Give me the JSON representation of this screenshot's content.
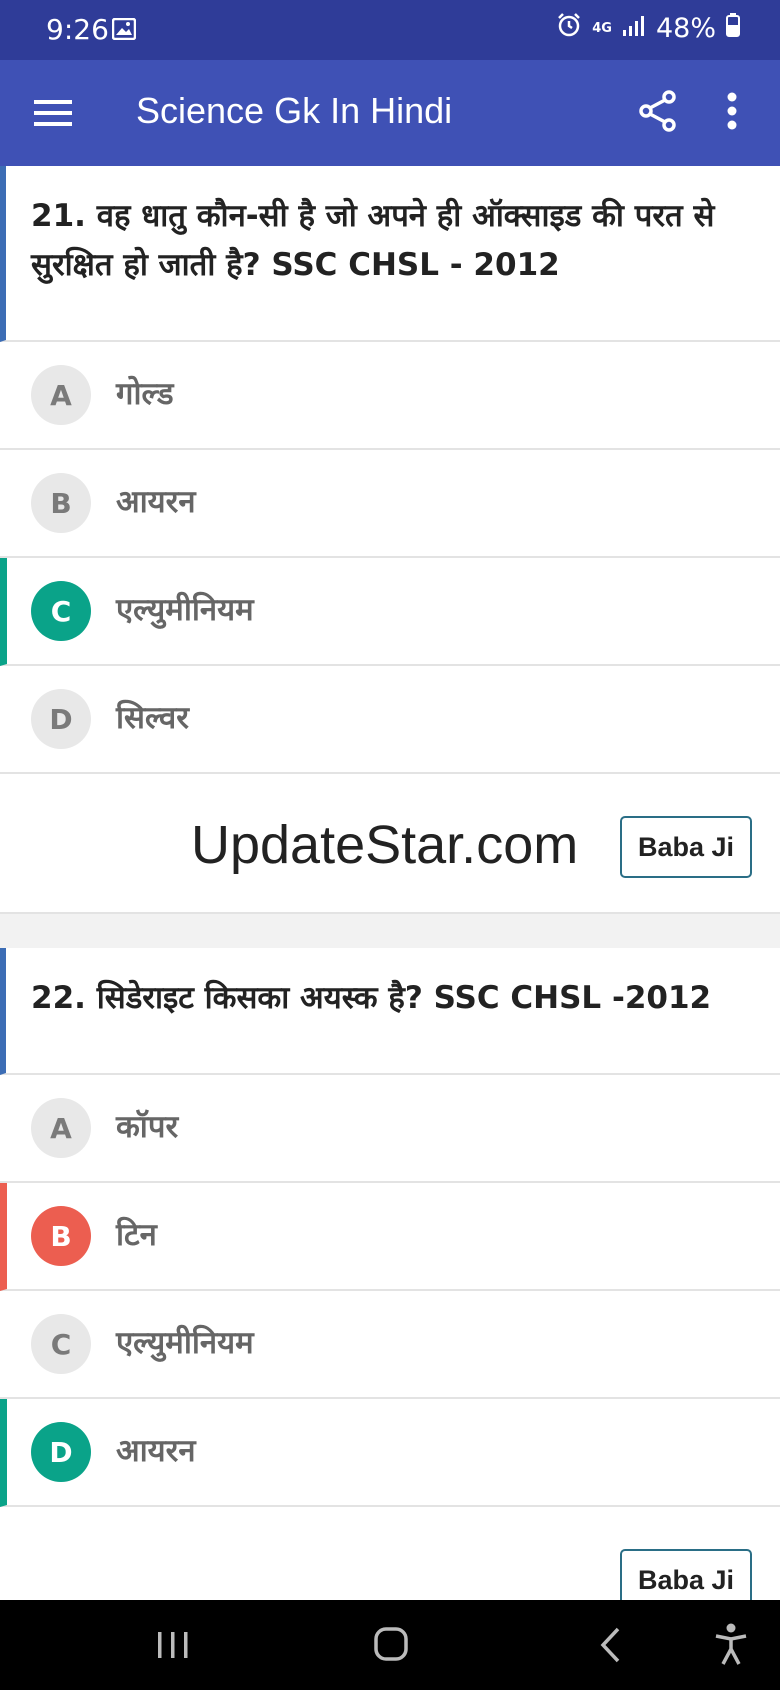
{
  "status_bar": {
    "time": "9:26",
    "network": "4G",
    "battery": "48%",
    "icons": [
      "image-icon",
      "alarm-icon",
      "signal-icon",
      "battery-icon"
    ]
  },
  "app_bar": {
    "title": "Science Gk In Hindi",
    "icons": [
      "menu-icon",
      "share-icon",
      "more-icon"
    ],
    "color": "#3f51b5"
  },
  "questions": [
    {
      "text": "21. वह धातु कौन-सी है जो अपने ही ऑक्साइड की परत से सुरक्षित हो जाती है? SSC CHSL - 2012",
      "options": [
        {
          "letter": "A",
          "label": "गोल्ड",
          "state": "none"
        },
        {
          "letter": "B",
          "label": "आयरन",
          "state": "none"
        },
        {
          "letter": "C",
          "label": "एल्युमीनियम",
          "state": "correct"
        },
        {
          "letter": "D",
          "label": "सिल्वर",
          "state": "none"
        }
      ]
    },
    {
      "text": "22. सिडेराइट किसका अयस्क है? SSC CHSL -2012",
      "options": [
        {
          "letter": "A",
          "label": "कॉपर",
          "state": "none"
        },
        {
          "letter": "B",
          "label": "टिन",
          "state": "wrong"
        },
        {
          "letter": "C",
          "label": "एल्युमीनियम",
          "state": "none"
        },
        {
          "letter": "D",
          "label": "आयरन",
          "state": "correct"
        }
      ]
    }
  ],
  "ad": {
    "brand": "UpdateStar.com",
    "button": "Baba Ji"
  },
  "bottom_ad": {
    "button": "Baba Ji"
  },
  "colors": {
    "correct": "#0aa389",
    "wrong": "#ec5e50",
    "question_bar": "#3c6db5",
    "status_bar": "#2f3c98"
  }
}
